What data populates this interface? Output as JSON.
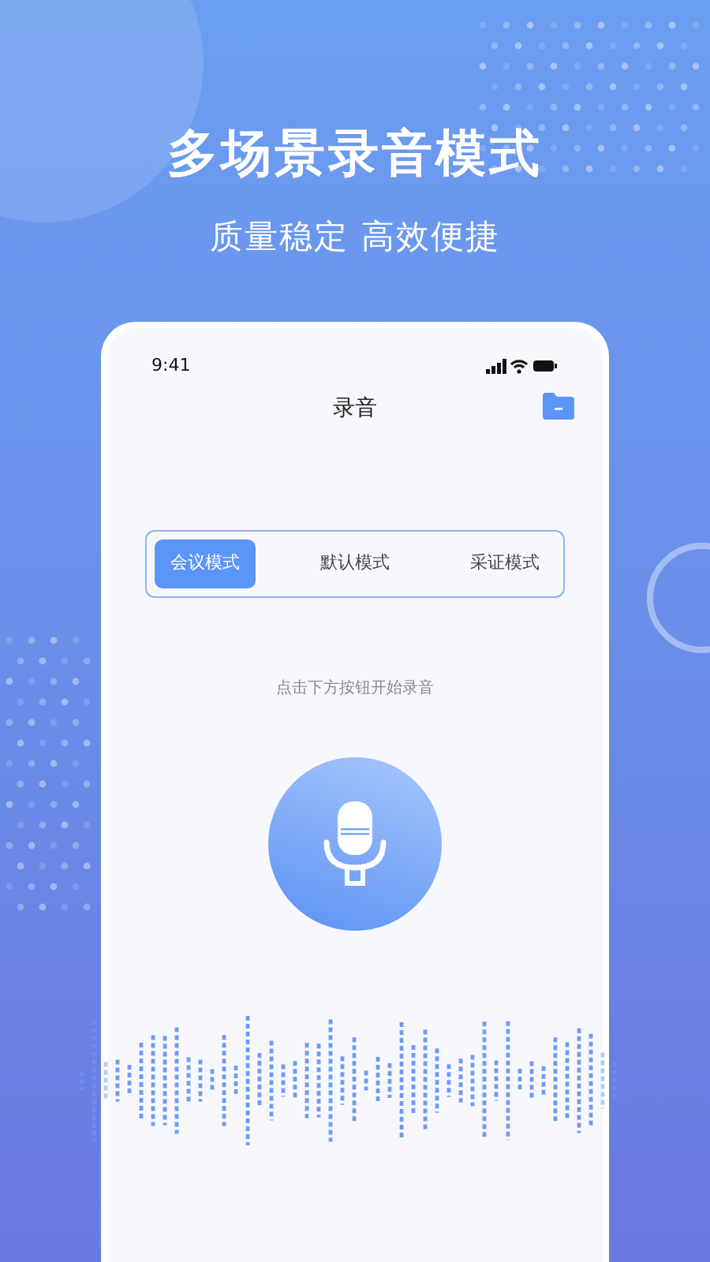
{
  "headline": "多场景录音模式",
  "subheadline": "质量稳定 高效便捷",
  "phone": {
    "status_bar": {
      "time": "9:41"
    },
    "title": "录音",
    "mode_tabs": [
      {
        "label": "会议模式",
        "selected": true
      },
      {
        "label": "默认模式",
        "selected": false
      },
      {
        "label": "采证模式",
        "selected": false
      }
    ],
    "hint": "点击下方按钮开始录音"
  }
}
